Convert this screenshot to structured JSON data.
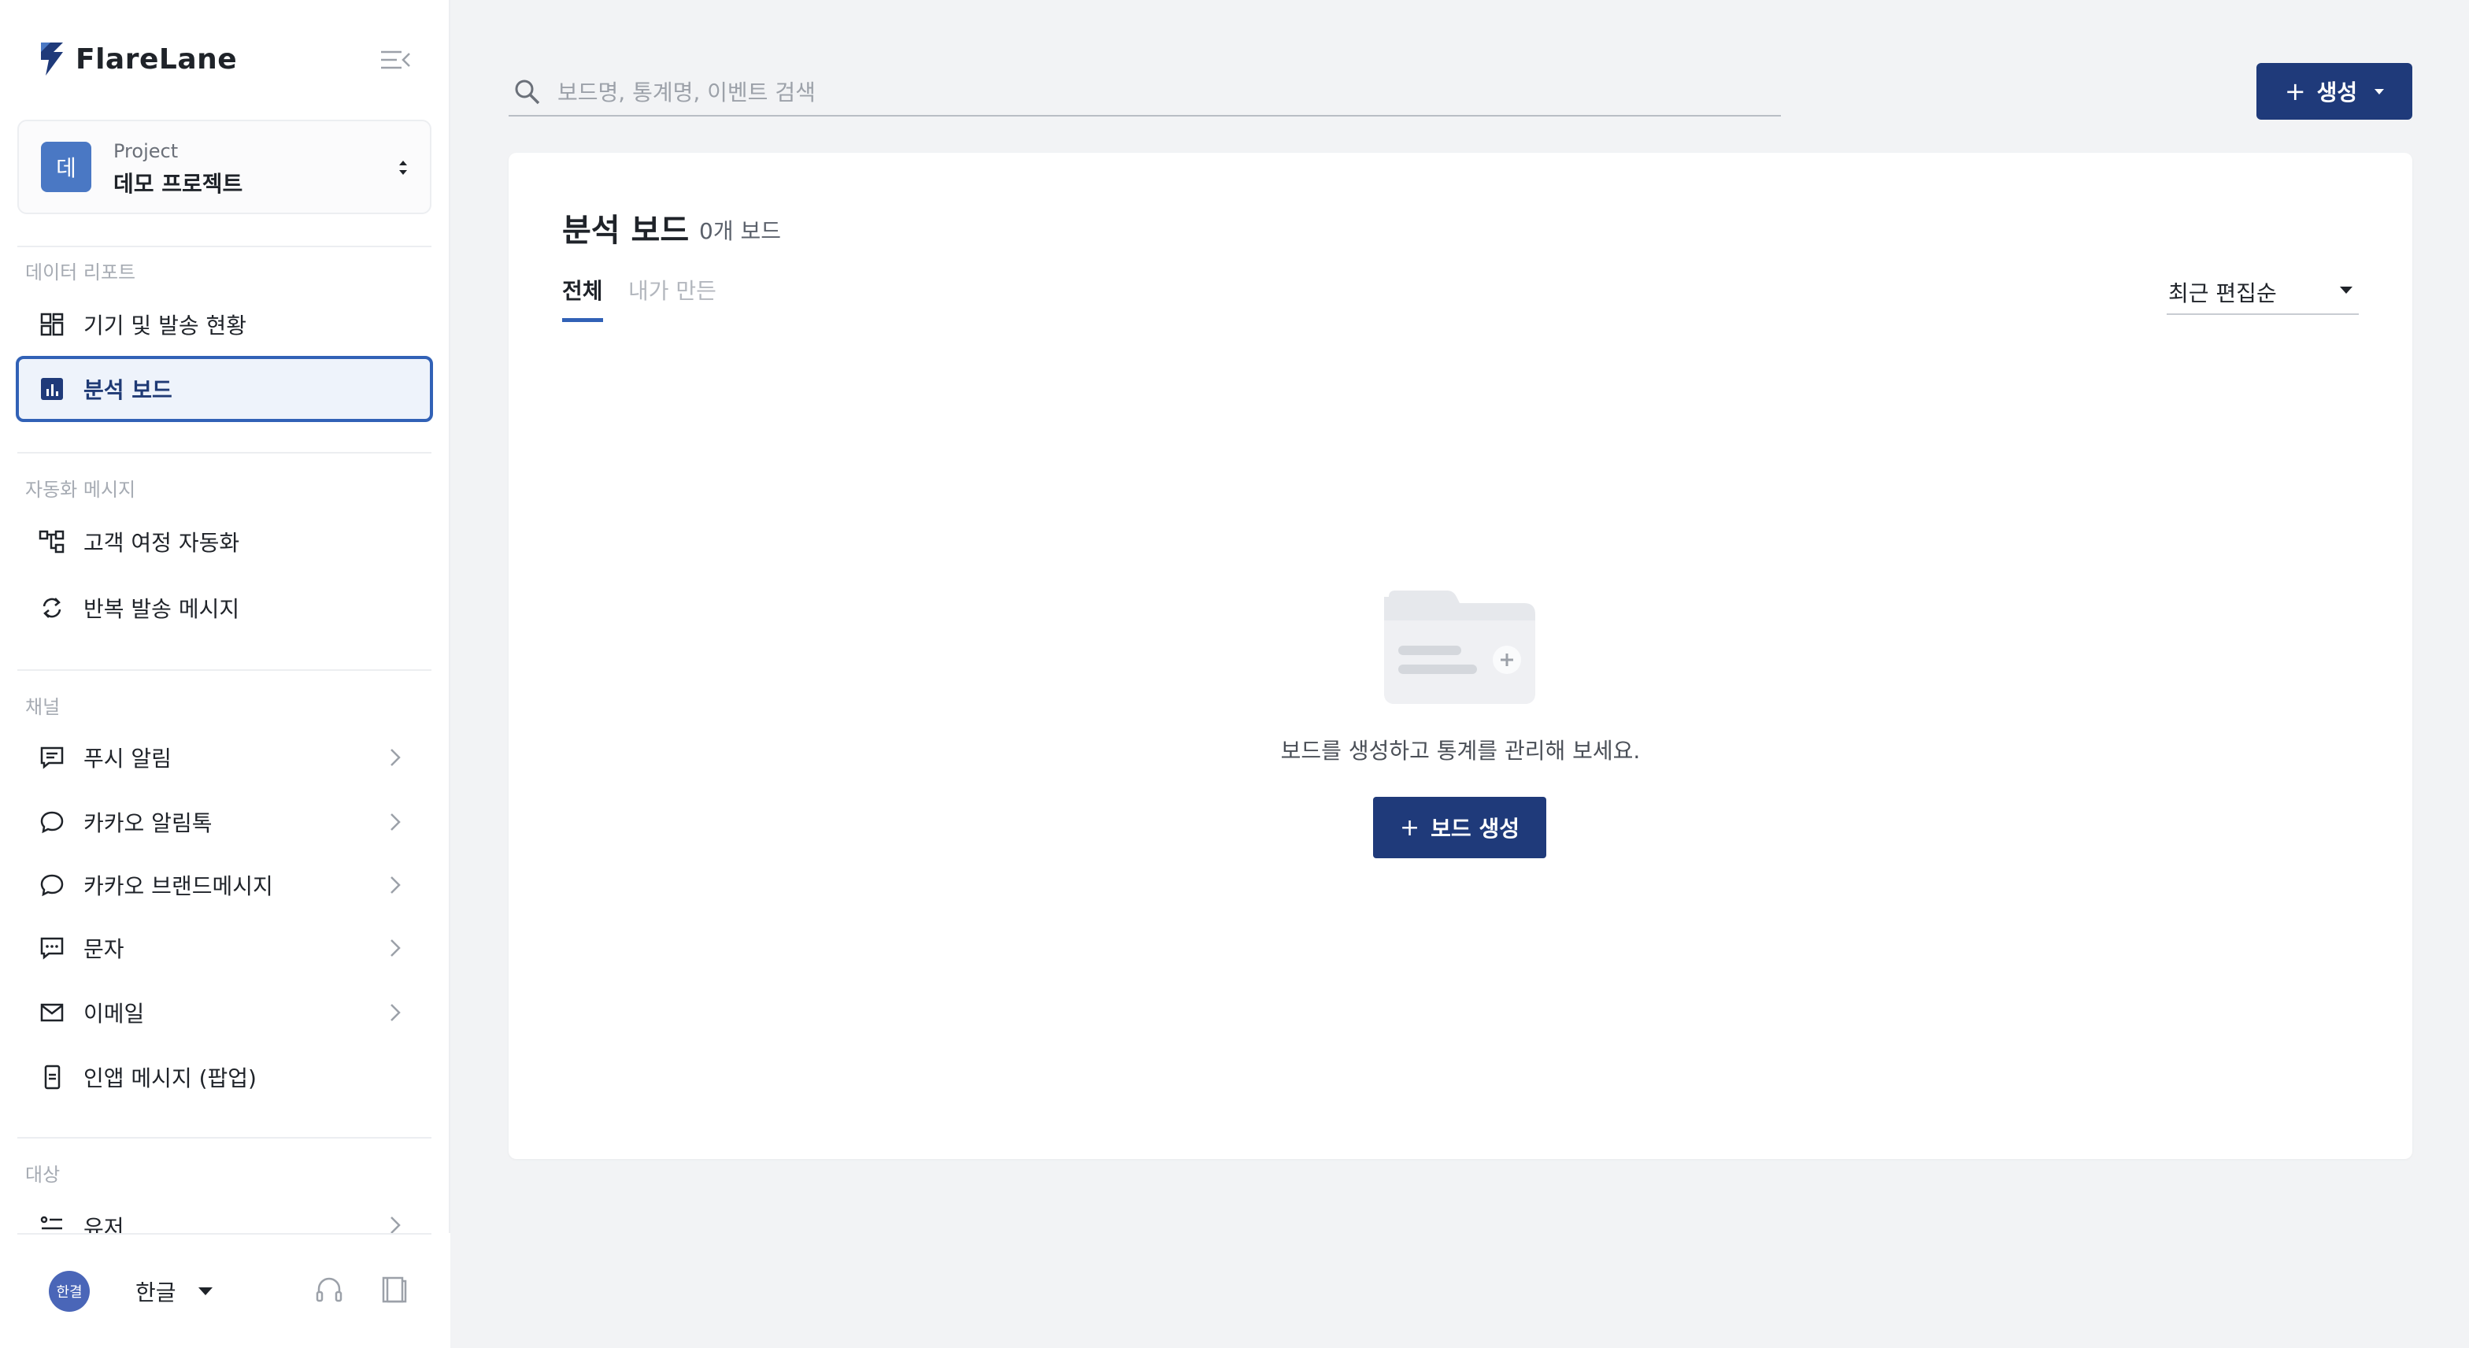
{
  "brand": {
    "name": "FlareLane"
  },
  "project": {
    "kicker": "Project",
    "name": "데모 프로젝트",
    "avatar_text": "데"
  },
  "sidebar": {
    "sections": [
      {
        "title": "데이터 리포트"
      },
      {
        "title": "자동화 메시지"
      },
      {
        "title": "채널"
      },
      {
        "title": "대상"
      }
    ],
    "items": [
      {
        "label": "기기 및 발송 현황",
        "icon": "grid-icon"
      },
      {
        "label": "분석 보드",
        "icon": "bar-chart-icon",
        "active": true
      },
      {
        "label": "고객 여정 자동화",
        "icon": "journey-icon"
      },
      {
        "label": "반복 발송 메시지",
        "icon": "repeat-icon"
      },
      {
        "label": "푸시 알림",
        "icon": "push-message-icon"
      },
      {
        "label": "카카오 알림톡",
        "icon": "chat-bubble-icon"
      },
      {
        "label": "카카오 브랜드메시지",
        "icon": "chat-bubble-icon"
      },
      {
        "label": "문자",
        "icon": "sms-icon"
      },
      {
        "label": "이메일",
        "icon": "mail-icon"
      },
      {
        "label": "인앱 메시지 (팝업)",
        "icon": "in-app-icon"
      },
      {
        "label": "유저",
        "icon": "user-list-icon"
      }
    ]
  },
  "footer": {
    "user_avatar_text": "한결",
    "language": "한글"
  },
  "search": {
    "placeholder": "보드명, 통계명, 이벤트 검색",
    "value": ""
  },
  "header": {
    "create_label": "생성"
  },
  "board": {
    "title": "분석 보드",
    "count_label": "0개 보드",
    "tabs": [
      {
        "label": "전체",
        "active": true
      },
      {
        "label": "내가 만든",
        "active": false
      }
    ],
    "sort_label": "최근 편집순",
    "empty_message": "보드를 생성하고 통계를 관리해 보세요.",
    "empty_button_label": "보드 생성"
  },
  "colors": {
    "primary": "#1f3a7a",
    "accent": "#3161b6",
    "active_bg": "#eef3fb"
  }
}
